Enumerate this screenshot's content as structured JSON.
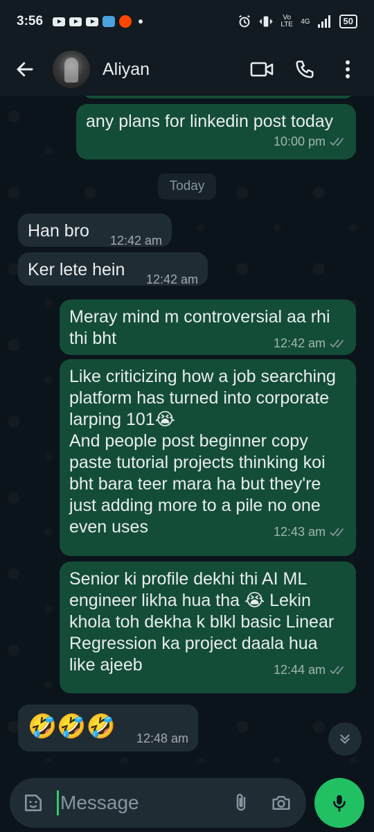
{
  "status_bar": {
    "time": "3:56",
    "network": "4G",
    "volte": "Vo LTE",
    "battery": "50"
  },
  "header": {
    "contact_name": "Aliyan",
    "icons": [
      "back-arrow-icon",
      "video-call-icon",
      "voice-call-icon",
      "more-vert-icon"
    ]
  },
  "chat": {
    "date_divider": "Today",
    "messages": [
      {
        "direction": "outgoing",
        "text": "any plans for linkedin post today",
        "time": "10:00 pm",
        "status": "read"
      },
      {
        "direction": "incoming",
        "text": "Han bro",
        "time": "12:42 am"
      },
      {
        "direction": "incoming",
        "text": "Ker lete hein",
        "time": "12:42 am"
      },
      {
        "direction": "outgoing",
        "text": "Meray mind m controversial aa rhi thi bht",
        "time": "12:42 am",
        "status": "read"
      },
      {
        "direction": "outgoing",
        "text": "Like criticizing how a job searching platform has turned into corporate larping 101😭\nAnd people post beginner copy paste tutorial projects thinking koi bht bara teer mara ha but they're just adding more to a pile no one even uses",
        "time": "12:43 am",
        "status": "read"
      },
      {
        "direction": "outgoing",
        "text": "Senior ki profile dekhi thi AI ML engineer likha hua tha 😭 Lekin khola toh dekha k blkl basic Linear Regression ka project daala hua like ajeeb",
        "time": "12:44 am",
        "status": "read"
      },
      {
        "direction": "incoming",
        "text": "🤣🤣🤣",
        "time": "12:48 am"
      }
    ]
  },
  "input": {
    "placeholder": "Message"
  },
  "colors": {
    "outgoing_bubble": "#144d37",
    "incoming_bubble": "#202c33",
    "background": "#0b141a",
    "accent": "#21c063",
    "read_ticks": "#8696a0"
  }
}
